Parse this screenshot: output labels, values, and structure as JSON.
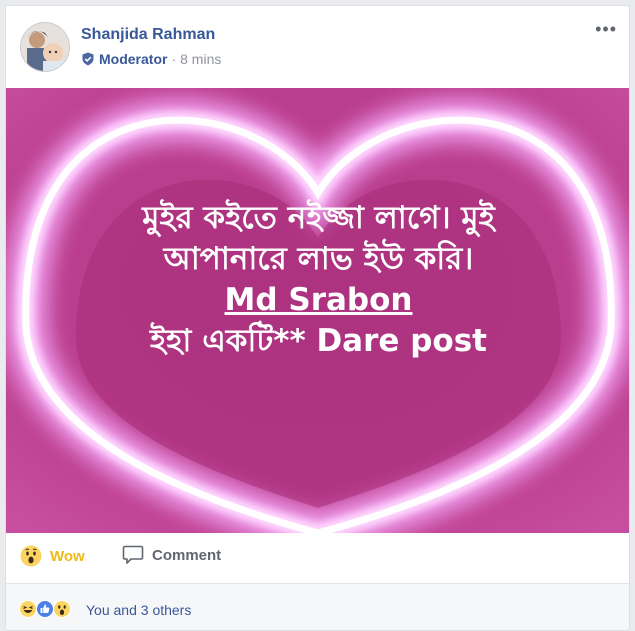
{
  "post": {
    "author": "Shanjida Rahman",
    "role": "Moderator",
    "separator": "·",
    "time": "8 mins",
    "caption_line1": "মুইর কইতে নইজ্জা লাগে। মুই",
    "caption_line2": "আপানারে লাভ ইউ করি।",
    "caption_name": "Md Srabon",
    "caption_line4": "ইহা একটি** Dare post"
  },
  "actions": {
    "reaction_label": "Wow",
    "comment_label": "Comment"
  },
  "summary": {
    "text": "You and 3 others"
  },
  "icons": {
    "more": "more-options-icon",
    "badge": "moderator-badge-icon",
    "wow": "wow-emoji-icon",
    "comment": "comment-bubble-icon",
    "haha": "haha-emoji-icon",
    "like": "like-thumb-icon"
  },
  "colors": {
    "link": "#385898",
    "wow": "#f0ba15",
    "heart_bg": "#b5317f",
    "neon": "#ffffff"
  }
}
